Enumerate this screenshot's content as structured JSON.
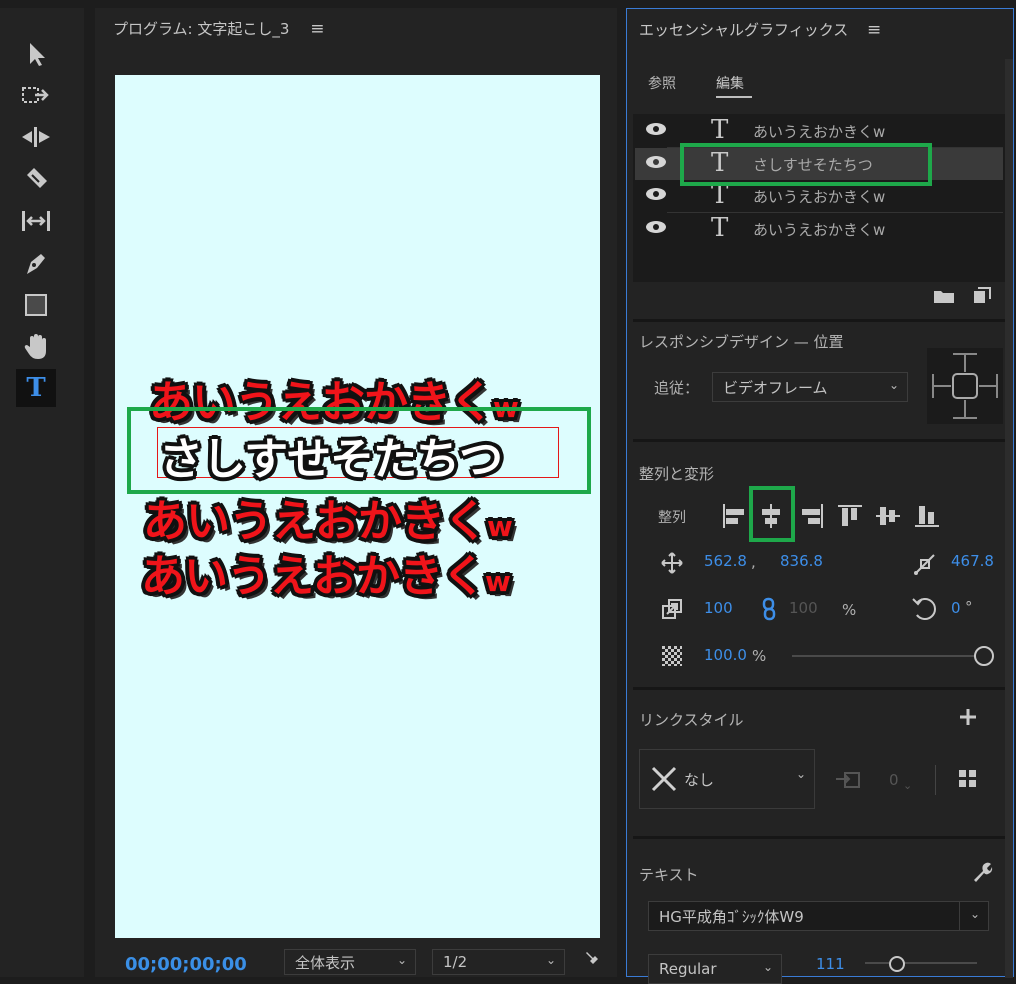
{
  "program": {
    "title": "プログラム: 文字起こし_3",
    "timecode": "00;00;00;00",
    "fit_label": "全体表示",
    "resolution_label": "1/2",
    "captions": [
      {
        "text": "あいうえおかきく",
        "suffix": "w",
        "style": "red"
      },
      {
        "text": "さしすせそたちつ",
        "suffix": "",
        "style": "white"
      },
      {
        "text": "あいうえおかきく",
        "suffix": "w",
        "style": "red"
      },
      {
        "text": "あいうえおかきく",
        "suffix": "w",
        "style": "red"
      }
    ],
    "canvas_color": "#ddfdfe"
  },
  "tools": [
    "selection-tool-icon",
    "track-select-icon",
    "ripple-edit-icon",
    "razor-icon",
    "slip-icon",
    "pen-icon",
    "rectangle-icon",
    "hand-icon",
    "type-icon"
  ],
  "essential": {
    "title": "エッセンシャルグラフィックス",
    "tabs": [
      {
        "label": "参照",
        "active": false
      },
      {
        "label": "編集",
        "active": true
      }
    ],
    "layers": [
      {
        "name": "あいうえおかきくw",
        "selected": false
      },
      {
        "name": "さしすせそたちつ",
        "selected": true
      },
      {
        "name": "あいうえおかきくw",
        "selected": false
      },
      {
        "name": "あいうえおかきくw",
        "selected": false
      }
    ],
    "responsive": {
      "heading": "レスポンシブデザイン — 位置",
      "follow_label": "追従：",
      "follow_value": "ビデオフレーム"
    },
    "align": {
      "heading": "整列と変形",
      "align_label": "整列",
      "pos_x": "562.8",
      "pos_sep": ",",
      "pos_y": "836.8",
      "anchor": "467.8",
      "scale": "100",
      "scale_linked": "100",
      "scale_unit": "%",
      "rotation": "0",
      "rotation_unit": "°",
      "opacity": "100.0",
      "opacity_unit": "%",
      "opacity_level": 1.0
    },
    "link_style": {
      "heading": "リンクスタイル",
      "value": "なし",
      "count": "0"
    },
    "text": {
      "heading": "テキスト",
      "font": "HG平成角ｺﾞｼｯｸ体W9",
      "style": "Regular",
      "size": "111"
    },
    "accent_color": "#3d8ee8",
    "highlight_color": "#1ea84a"
  }
}
